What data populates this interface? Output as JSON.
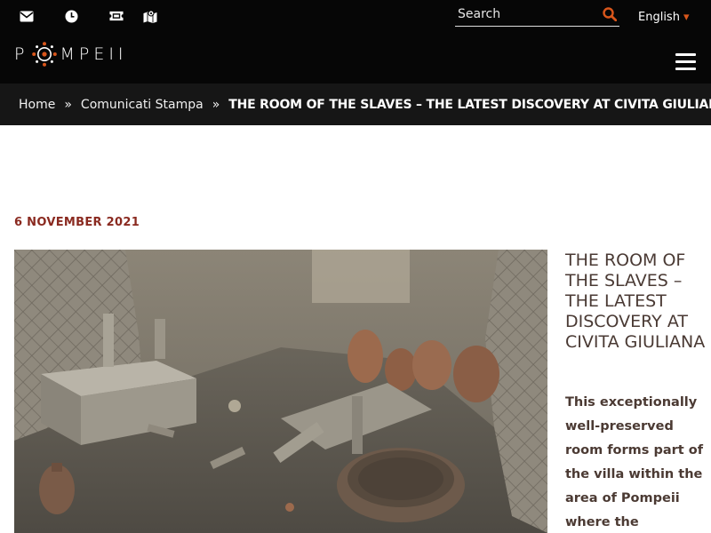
{
  "header": {
    "icons": [
      "mail-icon",
      "clock-icon",
      "ticket-icon",
      "map-icon"
    ],
    "search": {
      "placeholder": "Search",
      "icon": "search-icon"
    },
    "language": {
      "label": "English",
      "caret": "▾"
    },
    "logo": {
      "text_left": "P",
      "text_right": "MPEII"
    },
    "menu_icon": "hamburger-icon"
  },
  "breadcrumb": {
    "items": [
      "Home",
      "Comunicati Stampa",
      "THE ROOM OF THE SLAVES – THE LATEST DISCOVERY AT CIVITA GIULIANA"
    ],
    "separator": "»"
  },
  "article": {
    "date": "6 NOVEMBER 2021",
    "title": "THE ROOM OF THE SLAVES – THE LATEST DISCOVERY AT CIVITA GIULIANA",
    "lead": "This exceptionally well-preserved room forms part of the villa within the area of Pompeii where the"
  },
  "colors": {
    "header_bg": "#060606",
    "breadcrumb_bg": "#161616",
    "accent_orange": "#d9561b",
    "date_red": "#8a2a20",
    "title_brown": "#4a3a34"
  }
}
